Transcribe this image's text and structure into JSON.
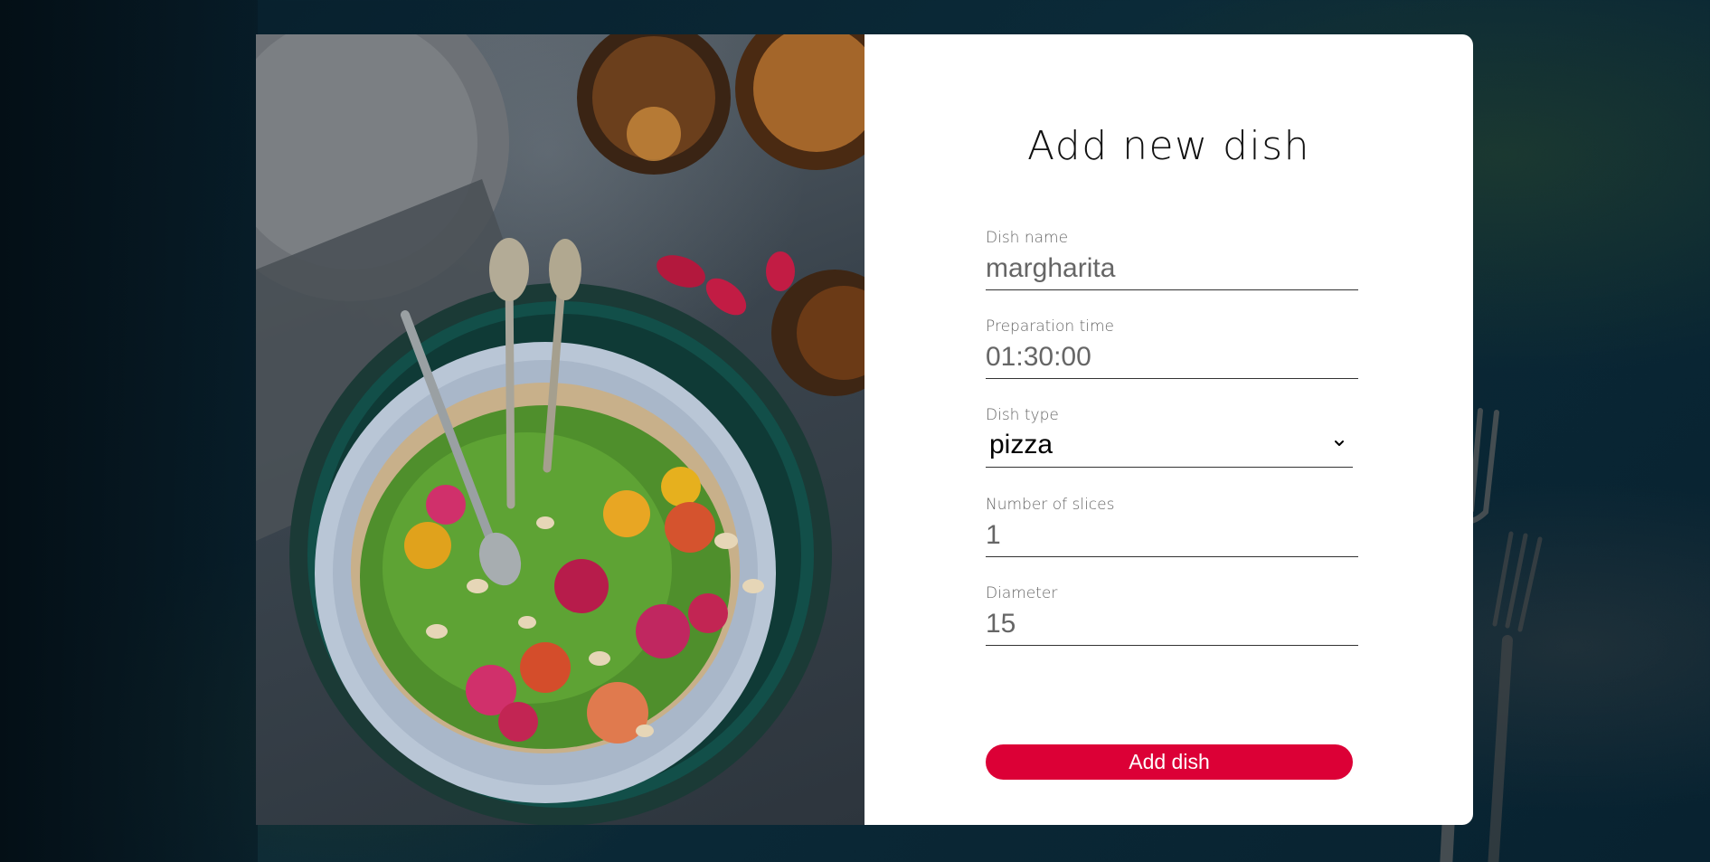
{
  "form": {
    "title": "Add new dish",
    "fields": {
      "dish_name": {
        "label": "Dish name",
        "value": "margharita"
      },
      "preparation_time": {
        "label": "Preparation time",
        "value": "01:30:00"
      },
      "dish_type": {
        "label": "Dish type",
        "selected": "pizza"
      },
      "number_of_slices": {
        "label": "Number of slices",
        "value": "1"
      },
      "diameter": {
        "label": "Diameter",
        "value": "15"
      }
    },
    "submit_label": "Add dish"
  },
  "colors": {
    "accent": "#dc0036",
    "background": "#0b2a38",
    "panel": "#ffffff"
  },
  "icons": {
    "select_chevron": "chevron-down-icon"
  }
}
